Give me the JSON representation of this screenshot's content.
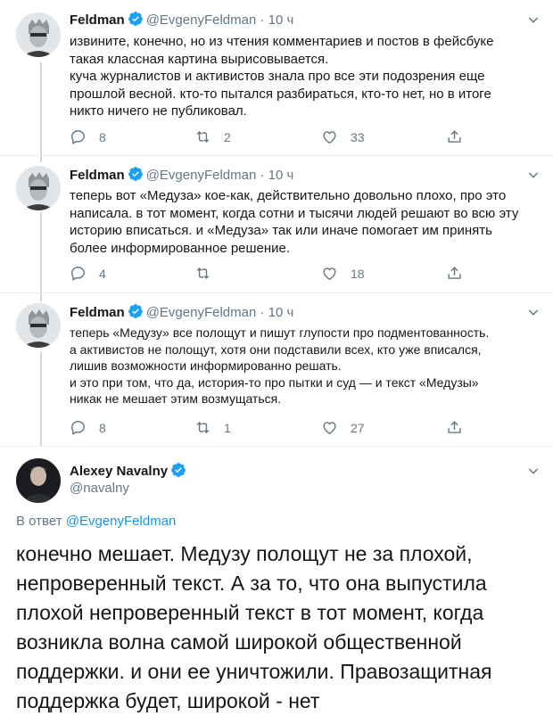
{
  "tweets": [
    {
      "name": "Feldman",
      "handle": "@EvgenyFeldman",
      "dot": "·",
      "time": "10 ч",
      "text": "извините, конечно, но из чтения комментариев и постов в фейсбуке\nтакая классная картина вырисовывается.\nкуча журналистов и активистов знала про все эти подозрения еще\nпрошлой весной. кто-то пытался разбираться, кто-то нет, но в итоге\nникто ничего не публиковал.",
      "replies": "8",
      "retweets": "2",
      "likes": "33"
    },
    {
      "name": "Feldman",
      "handle": "@EvgenyFeldman",
      "dot": "·",
      "time": "10 ч",
      "text": "теперь вот «Медуза» кое-как, действительно довольно плохо, про это\nнаписала. в тот момент, когда сотни и тысячи людей решают во всю эту\nисторию вписаться. и «Медуза» так или иначе помогает им принять\nболее информированное решение.",
      "replies": "4",
      "retweets": "",
      "likes": "18"
    },
    {
      "name": "Feldman",
      "handle": "@EvgenyFeldman",
      "dot": "·",
      "time": "10 ч",
      "text": "теперь «Медузу» все полощут и пишут глупости про подментованность.\nа активистов не полощут, хотя они подставили всех, кто уже вписался,\nлишив  возможности информированно решать.\nи это при том, что да, история-то про пытки и суд — и текст «Медузы»\nникак не мешает этим возмущаться.",
      "replies": "8",
      "retweets": "1",
      "likes": "27"
    }
  ],
  "main_tweet": {
    "name": "Alexey Navalny",
    "handle": "@navalny",
    "reply_prefix": "В ответ ",
    "reply_to": "@EvgenyFeldman",
    "text": "конечно мешает. Медузу полощут не за плохой,\nнепроверенный текст. А за то, что она выпустила\nплохой непроверенный текст в тот момент, когда\nвозникла волна самой широкой общественной\nподдержки. и они ее уничтожили. Правозащитная\nподдержка будет, широкой - нет"
  },
  "colors": {
    "verified": "#1da1f2",
    "link": "#1b95e0",
    "secondary": "#657786",
    "divider": "#e6ecf0"
  },
  "icons": [
    "verified-icon",
    "chevron-down-icon",
    "reply-icon",
    "retweet-icon",
    "like-icon",
    "share-icon"
  ]
}
